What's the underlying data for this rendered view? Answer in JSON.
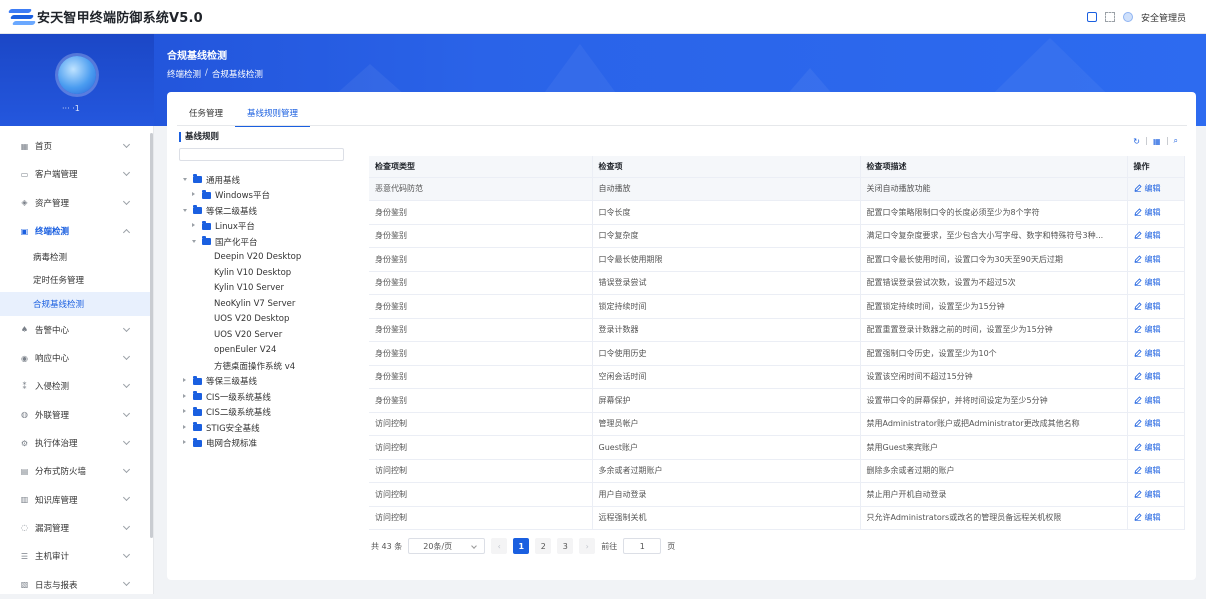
{
  "app": {
    "title": "安天智甲终端防御系统V5.0",
    "user": "安全管理员"
  },
  "sidebar": {
    "user_label": "··· ·1",
    "items": [
      {
        "label": "首页",
        "icon": "grid-icon",
        "glyph": "▦"
      },
      {
        "label": "客户端管理",
        "icon": "monitor-icon",
        "glyph": "▭"
      },
      {
        "label": "资产管理",
        "icon": "layers-icon",
        "glyph": "◈"
      },
      {
        "label": "终端检测",
        "icon": "terminal-icon",
        "glyph": "▣"
      },
      {
        "label": "告警中心",
        "icon": "bell-icon",
        "glyph": "♠"
      },
      {
        "label": "响应中心",
        "icon": "response-icon",
        "glyph": "◉"
      },
      {
        "label": "入侵检测",
        "icon": "intrusion-icon",
        "glyph": "⁑"
      },
      {
        "label": "外联管理",
        "icon": "globe-icon",
        "glyph": "◍"
      },
      {
        "label": "执行体治理",
        "icon": "gear-icon",
        "glyph": "⚙"
      },
      {
        "label": "分布式防火墙",
        "icon": "firewall-icon",
        "glyph": "▤"
      },
      {
        "label": "知识库管理",
        "icon": "book-icon",
        "glyph": "▥"
      },
      {
        "label": "漏洞管理",
        "icon": "bug-icon",
        "glyph": "◌"
      },
      {
        "label": "主机审计",
        "icon": "list-icon",
        "glyph": "☰"
      },
      {
        "label": "日志与报表",
        "icon": "report-icon",
        "glyph": "▧"
      }
    ],
    "sub_items": [
      {
        "label": "病毒检测"
      },
      {
        "label": "定时任务管理"
      },
      {
        "label": "合规基线检测"
      }
    ]
  },
  "header": {
    "page_title": "合规基线检测",
    "breadcrumb": [
      "终端检测",
      "/",
      "合规基线检测"
    ]
  },
  "tabs": [
    {
      "label": "任务管理"
    },
    {
      "label": "基线规则管理"
    }
  ],
  "tree": {
    "title": "基线规则",
    "nodes": [
      {
        "label": "通用基线",
        "level": 0,
        "open": true
      },
      {
        "label": "Windows平台",
        "level": 1,
        "open": false
      },
      {
        "label": "等保二级基线",
        "level": 0,
        "open": true
      },
      {
        "label": "Linux平台",
        "level": 1,
        "open": false
      },
      {
        "label": "国产化平台",
        "level": 1,
        "open": true
      },
      {
        "label": "Deepin V20 Desktop",
        "level": 2
      },
      {
        "label": "Kylin V10 Desktop",
        "level": 2
      },
      {
        "label": "Kylin V10 Server",
        "level": 2
      },
      {
        "label": "NeoKylin V7 Server",
        "level": 2
      },
      {
        "label": "UOS V20 Desktop",
        "level": 2
      },
      {
        "label": "UOS V20 Server",
        "level": 2
      },
      {
        "label": "openEuler V24",
        "level": 2
      },
      {
        "label": "方德桌面操作系统 v4",
        "level": 2
      },
      {
        "label": "等保三级基线",
        "level": 0,
        "open": false
      },
      {
        "label": "CIS一级系统基线",
        "level": 0,
        "open": false
      },
      {
        "label": "CIS二级系统基线",
        "level": 0,
        "open": false
      },
      {
        "label": "STIG安全基线",
        "level": 0,
        "open": false
      },
      {
        "label": "电网合规标准",
        "level": 0,
        "open": false
      }
    ]
  },
  "table": {
    "columns": [
      "检查项类型",
      "检查项",
      "检查项描述",
      "操作"
    ],
    "edit_label": "编辑",
    "rows": [
      [
        "恶意代码防范",
        "自动播放",
        "关闭自动播放功能"
      ],
      [
        "身份鉴别",
        "口令长度",
        "配置口令策略限制口令的长度必须至少为8个字符"
      ],
      [
        "身份鉴别",
        "口令复杂度",
        "满足口令复杂度要求，至少包含大小写字母、数字和特殊符号3种..."
      ],
      [
        "身份鉴别",
        "口令最长使用期限",
        "配置口令最长使用时间，设置口令为30天至90天后过期"
      ],
      [
        "身份鉴别",
        "错误登录尝试",
        "配置错误登录尝试次数，设置为不超过5次"
      ],
      [
        "身份鉴别",
        "锁定持续时间",
        "配置锁定持续时间，设置至少为15分钟"
      ],
      [
        "身份鉴别",
        "登录计数器",
        "配置重置登录计数器之前的时间，设置至少为15分钟"
      ],
      [
        "身份鉴别",
        "口令使用历史",
        "配置强制口令历史，设置至少为10个"
      ],
      [
        "身份鉴别",
        "空闲会话时间",
        "设置该空闲时间不超过15分钟"
      ],
      [
        "身份鉴别",
        "屏幕保护",
        "设置带口令的屏幕保护，并将时间设定为至少5分钟"
      ],
      [
        "访问控制",
        "管理员帐户",
        "禁用Administrator账户或把Administrator更改成其他名称"
      ],
      [
        "访问控制",
        "Guest账户",
        "禁用Guest来宾账户"
      ],
      [
        "访问控制",
        "多余或者过期账户",
        "删除多余或者过期的账户"
      ],
      [
        "访问控制",
        "用户自动登录",
        "禁止用户开机自动登录"
      ],
      [
        "访问控制",
        "远程强制关机",
        "只允许Administrators或改名的管理员备远程关机权限"
      ]
    ]
  },
  "pager": {
    "total": "共 43 条",
    "page_size": "20条/页",
    "pages": [
      "1",
      "2",
      "3"
    ],
    "current": "1",
    "goto_label": "前往",
    "goto_value": "1",
    "page_unit": "页"
  },
  "colors": {
    "primary": "#1a5fe0",
    "banner": "#2a63e8"
  }
}
